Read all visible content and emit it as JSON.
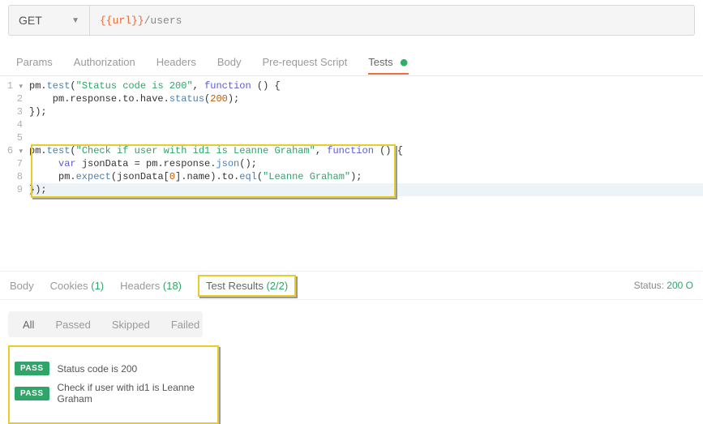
{
  "request": {
    "method": "GET",
    "url_var": "{{url}}",
    "url_path": "/users"
  },
  "request_tabs": {
    "params": "Params",
    "authorization": "Authorization",
    "headers": "Headers",
    "body": "Body",
    "prerequest": "Pre-request Script",
    "tests": "Tests"
  },
  "code": {
    "l1_a": "pm.",
    "l1_b": "test",
    "l1_c": "(",
    "l1_d": "\"Status code is 200\"",
    "l1_e": ", ",
    "l1_f": "function",
    "l1_g": " () {",
    "l2_a": "    pm.response.to.have.",
    "l2_b": "status",
    "l2_c": "(",
    "l2_d": "200",
    "l2_e": ");",
    "l3": "});",
    "l4": "",
    "l5": "",
    "l6_a": "pm.",
    "l6_b": "test",
    "l6_c": "(",
    "l6_d": "\"Check if user with id1 is Leanne Graham\"",
    "l6_e": ", ",
    "l6_f": "function",
    "l6_g": " () {",
    "l7_a": "     ",
    "l7_b": "var",
    "l7_c": " jsonData = pm.response.",
    "l7_d": "json",
    "l7_e": "();",
    "l8_a": "     pm.",
    "l8_b": "expect",
    "l8_c": "(jsonData[",
    "l8_d": "0",
    "l8_e": "].name).to.",
    "l8_f": "eql",
    "l8_g": "(",
    "l8_h": "\"Leanne Graham\"",
    "l8_i": ");",
    "l9": "});",
    "line_numbers": [
      "1",
      "2",
      "3",
      "4",
      "5",
      "6",
      "7",
      "8",
      "9"
    ]
  },
  "response_tabs": {
    "body": "Body",
    "cookies": "Cookies",
    "cookies_count": "(1)",
    "headers": "Headers",
    "headers_count": "(18)",
    "test_results": "Test Results",
    "test_results_count": "(2/2)"
  },
  "status": {
    "label": "Status:",
    "code": "200 O"
  },
  "filters": {
    "all": "All",
    "passed": "Passed",
    "skipped": "Skipped",
    "failed": "Failed"
  },
  "results": [
    {
      "badge": "PASS",
      "label": "Status code is 200"
    },
    {
      "badge": "PASS",
      "label": "Check if user with id1 is Leanne Graham"
    }
  ]
}
